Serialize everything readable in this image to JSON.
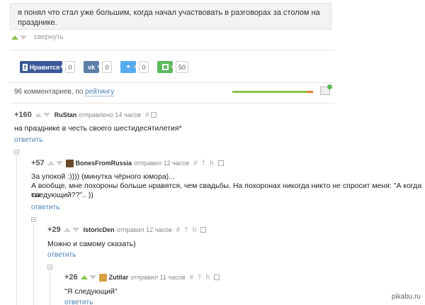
{
  "top_comment": {
    "text": "я понял что стал уже большим, когда начал участвовать в разговорах за столом на празднике.",
    "collapse_label": "свернуть"
  },
  "share": {
    "like_label": "Нравится",
    "like_count": "0",
    "vk_count": "0",
    "twitter_count": "0",
    "save_count": "50",
    "colors": {
      "facebook": "#3b5998",
      "vk": "#5b7fa6",
      "twitter": "#55acee",
      "save": "#5cb85c"
    }
  },
  "comments_header": {
    "prefix": "96 комментариев, по",
    "sort_label": "рейтингу"
  },
  "comments": [
    {
      "score": "+160",
      "user": "RuStan",
      "meta": "отправлено 14 часов",
      "text": "на празднике в честь своего шестидесятилетия*",
      "reply": "ответить"
    },
    {
      "score": "+57",
      "user": "BonesFromRussia",
      "meta": "отправил 12 часов",
      "text_line1": "За упокой :)))) (минутка чёрного юмора)...",
      "text_line2": "А вообще, мне похороны больше нравятся, чем свадьбы. На похоронах никогда никто не спросит меня: \"А когда ты",
      "text_line3": "следующий??\".. ))",
      "reply": "ответить"
    },
    {
      "score": "+29",
      "user": "IstoricDen",
      "meta": "отправил 12 часов",
      "text": "Можно и самому сказать)",
      "reply": "ответить"
    },
    {
      "score": "+26",
      "user": "Zutilar",
      "meta": "отправил 11 часов",
      "text": "\"Я следующий\"",
      "reply": "ответить"
    }
  ],
  "icons": {
    "hash": "#",
    "dagger": "†",
    "h": "h"
  },
  "watermark": "pikabu.ru"
}
